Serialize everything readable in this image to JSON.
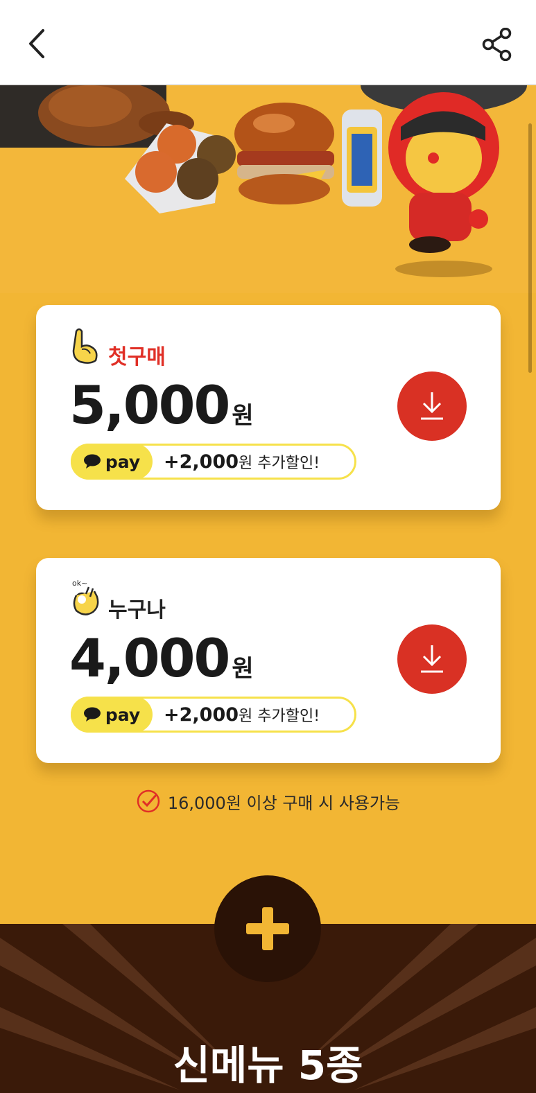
{
  "header": {
    "back_icon": "chevron-left-icon",
    "share_icon": "share-icon"
  },
  "coupons": [
    {
      "label": "첫구매",
      "amount": "5,000",
      "currency": "원",
      "pay_badge": "pay",
      "pay_extra_amount": "+2,000",
      "pay_extra_text": "원 추가할인!",
      "icon": "finger-up-hand-icon",
      "label_color": "#e02f26"
    },
    {
      "label": "누구나",
      "amount": "4,000",
      "currency": "원",
      "pay_badge": "pay",
      "pay_extra_amount": "+2,000",
      "pay_extra_text": "원 추가할인!",
      "icon": "ok-hand-icon",
      "label_color": "#222222"
    }
  ],
  "condition_text": "16,000원 이상 구매 시 사용가능",
  "section_title": "신메뉴 5종",
  "colors": {
    "background": "#f2b634",
    "download_button": "#d93124",
    "pay_yellow": "#f6e14a",
    "bottom_bg": "#3a1a09"
  }
}
